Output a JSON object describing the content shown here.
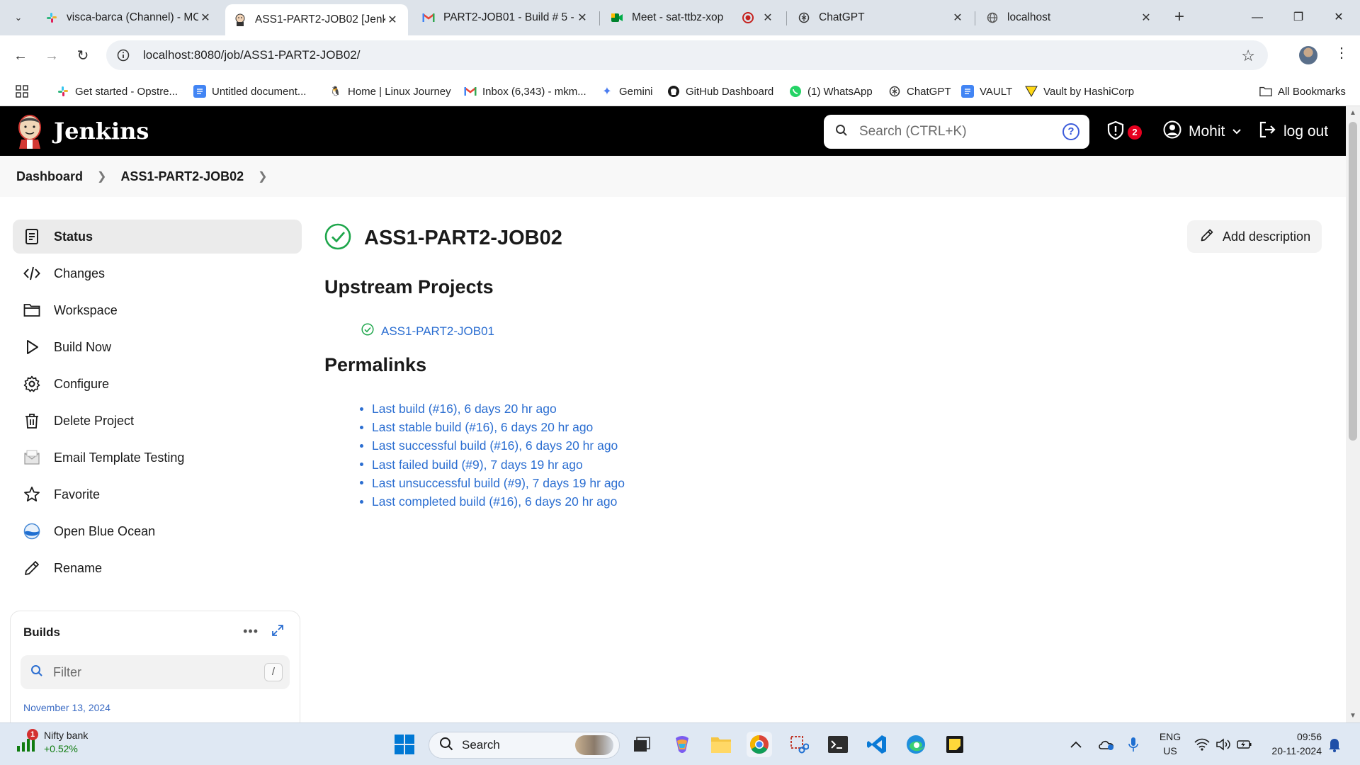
{
  "browser": {
    "tabs": [
      {
        "title": "visca-barca (Channel) - MC",
        "icon": "slack-icon",
        "active": false
      },
      {
        "title": "ASS1-PART2-JOB02 [Jenkin",
        "icon": "jenkins-icon",
        "active": true
      },
      {
        "title": "PART2-JOB01 - Build # 5 -",
        "icon": "gmail-icon",
        "active": false
      },
      {
        "title": "Meet - sat-ttbz-xop",
        "icon": "meet-icon",
        "active": false
      },
      {
        "title": "",
        "icon": "record-icon",
        "active": false
      },
      {
        "title": "ChatGPT",
        "icon": "chatgpt-icon",
        "active": false
      },
      {
        "title": "localhost",
        "icon": "globe-icon",
        "active": false
      }
    ],
    "url": "localhost:8080/job/ASS1-PART2-JOB02/",
    "bookmarks": [
      {
        "label": "Get started - Opstre...",
        "icon": "slack-icon"
      },
      {
        "label": "Untitled document...",
        "icon": "docs-icon"
      },
      {
        "label": "Home | Linux Journey",
        "icon": "linux-icon"
      },
      {
        "label": "Inbox (6,343) - mkm...",
        "icon": "gmail-icon"
      },
      {
        "label": "Gemini",
        "icon": "gemini-icon"
      },
      {
        "label": "GitHub Dashboard",
        "icon": "github-icon"
      },
      {
        "label": "(1) WhatsApp",
        "icon": "whatsapp-icon"
      },
      {
        "label": "ChatGPT",
        "icon": "chatgpt-icon"
      },
      {
        "label": "VAULT",
        "icon": "docs-icon"
      },
      {
        "label": "Vault by HashiCorp",
        "icon": "vault-icon"
      }
    ],
    "all_bookmarks": "All Bookmarks"
  },
  "jenkins": {
    "brand": "Jenkins",
    "search_placeholder": "Search (CTRL+K)",
    "security_count": "2",
    "user": "Mohit",
    "logout": "log out",
    "breadcrumb": [
      "Dashboard",
      "ASS1-PART2-JOB02"
    ],
    "sidebar": [
      {
        "label": "Status",
        "icon": "status-icon"
      },
      {
        "label": "Changes",
        "icon": "code-icon"
      },
      {
        "label": "Workspace",
        "icon": "folder-icon"
      },
      {
        "label": "Build Now",
        "icon": "play-icon"
      },
      {
        "label": "Configure",
        "icon": "gear-icon"
      },
      {
        "label": "Delete Project",
        "icon": "trash-icon"
      },
      {
        "label": "Email Template Testing",
        "icon": "email-icon"
      },
      {
        "label": "Favorite",
        "icon": "star-icon"
      },
      {
        "label": "Open Blue Ocean",
        "icon": "blue-ocean-icon"
      },
      {
        "label": "Rename",
        "icon": "pencil-icon"
      }
    ],
    "builds": {
      "title": "Builds",
      "filter_placeholder": "Filter",
      "filter_key": "/",
      "date": "November 13, 2024"
    },
    "job_title": "ASS1-PART2-JOB02",
    "add_description": "Add description",
    "upstream_heading": "Upstream Projects",
    "upstream": [
      "ASS1-PART2-JOB01"
    ],
    "permalinks_heading": "Permalinks",
    "permalinks": [
      "Last build (#16), 6 days 20 hr ago",
      "Last stable build (#16), 6 days 20 hr ago",
      "Last successful build (#16), 6 days 20 hr ago",
      "Last failed build (#9), 7 days 19 hr ago",
      "Last unsuccessful build (#9), 7 days 19 hr ago",
      "Last completed build (#16), 6 days 20 hr ago"
    ]
  },
  "taskbar": {
    "widget_name": "Nifty bank",
    "widget_change": "+0.52%",
    "widget_badge": "1",
    "search_placeholder": "Search",
    "lang_top": "ENG",
    "lang_bottom": "US",
    "time": "09:56",
    "date": "20-11-2024"
  },
  "colors": {
    "jenkins_header": "#000000",
    "link": "#2b6ed1",
    "success": "#1ea64b",
    "badge_red": "#e6001f"
  }
}
